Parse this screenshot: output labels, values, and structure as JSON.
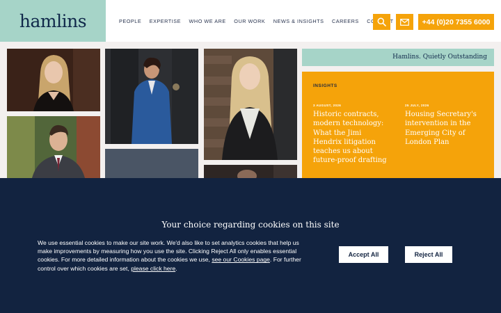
{
  "header": {
    "logo": "hamlins",
    "nav": [
      "PEOPLE",
      "EXPERTISE",
      "WHO WE ARE",
      "OUR WORK",
      "NEWS & INSIGHTS",
      "CAREERS",
      "CONTACT"
    ],
    "phone": "+44 (0)20 7355 6000",
    "accent_color": "#f5a30a",
    "brand_color": "#a6d4c8",
    "icons": [
      "search-icon",
      "mail-icon"
    ]
  },
  "tagline": "Hamlins. Quietly Outstanding",
  "insights": {
    "heading": "INSIGHTS",
    "articles": [
      {
        "date": "3 AUGUST, 2026",
        "title": "Historic contracts, modern technology: What the Jimi Hendrix litigation teaches us about future-proof drafting"
      },
      {
        "date": "25 JULY, 2026",
        "title": "Housing Secretary's intervention in the Emerging City of London Plan"
      }
    ]
  },
  "cookie": {
    "title": "Your choice regarding cookies on this site",
    "text_main": "We use essential cookies to make our site work. We'd also like to set analytics cookies that help us make improvements by measuring how you use the site. Clicking Reject All only enables essential cookies. For more detailed information about the cookies we use, ",
    "link1": "see our Cookies page",
    "text_mid": ". For further control over which cookies are set, ",
    "link2": "please click here",
    "text_end": ".",
    "accept_label": "Accept All",
    "reject_label": "Reject All",
    "background_color": "#122340"
  }
}
